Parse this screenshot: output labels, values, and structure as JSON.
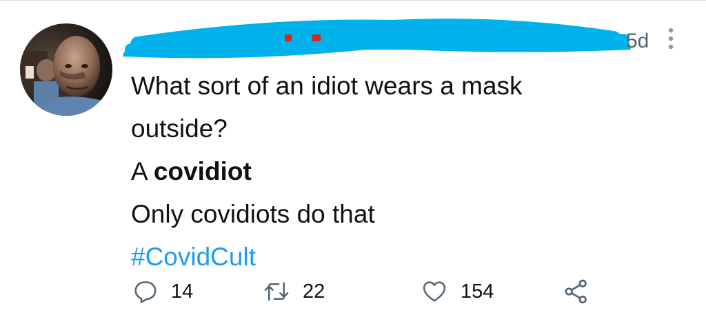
{
  "tweet": {
    "timestamp": "5d",
    "lines": [
      "What sort of an idiot wears a mask",
      "outside?"
    ],
    "line3_prefix": "A ",
    "line3_bold": "covidiot",
    "line4": "Only covidiots do that",
    "hashtag": "#CovidCult"
  },
  "actions": {
    "reply_count": "14",
    "retweet_count": "22",
    "like_count": "154"
  },
  "icons": {
    "reply": "reply-icon",
    "retweet": "retweet-icon",
    "like": "heart-icon",
    "share": "share-icon",
    "more": "more-vertical-icon"
  },
  "colors": {
    "hashtag": "#1d9bf0",
    "redaction": "#00b2ec",
    "muted": "#536471"
  }
}
